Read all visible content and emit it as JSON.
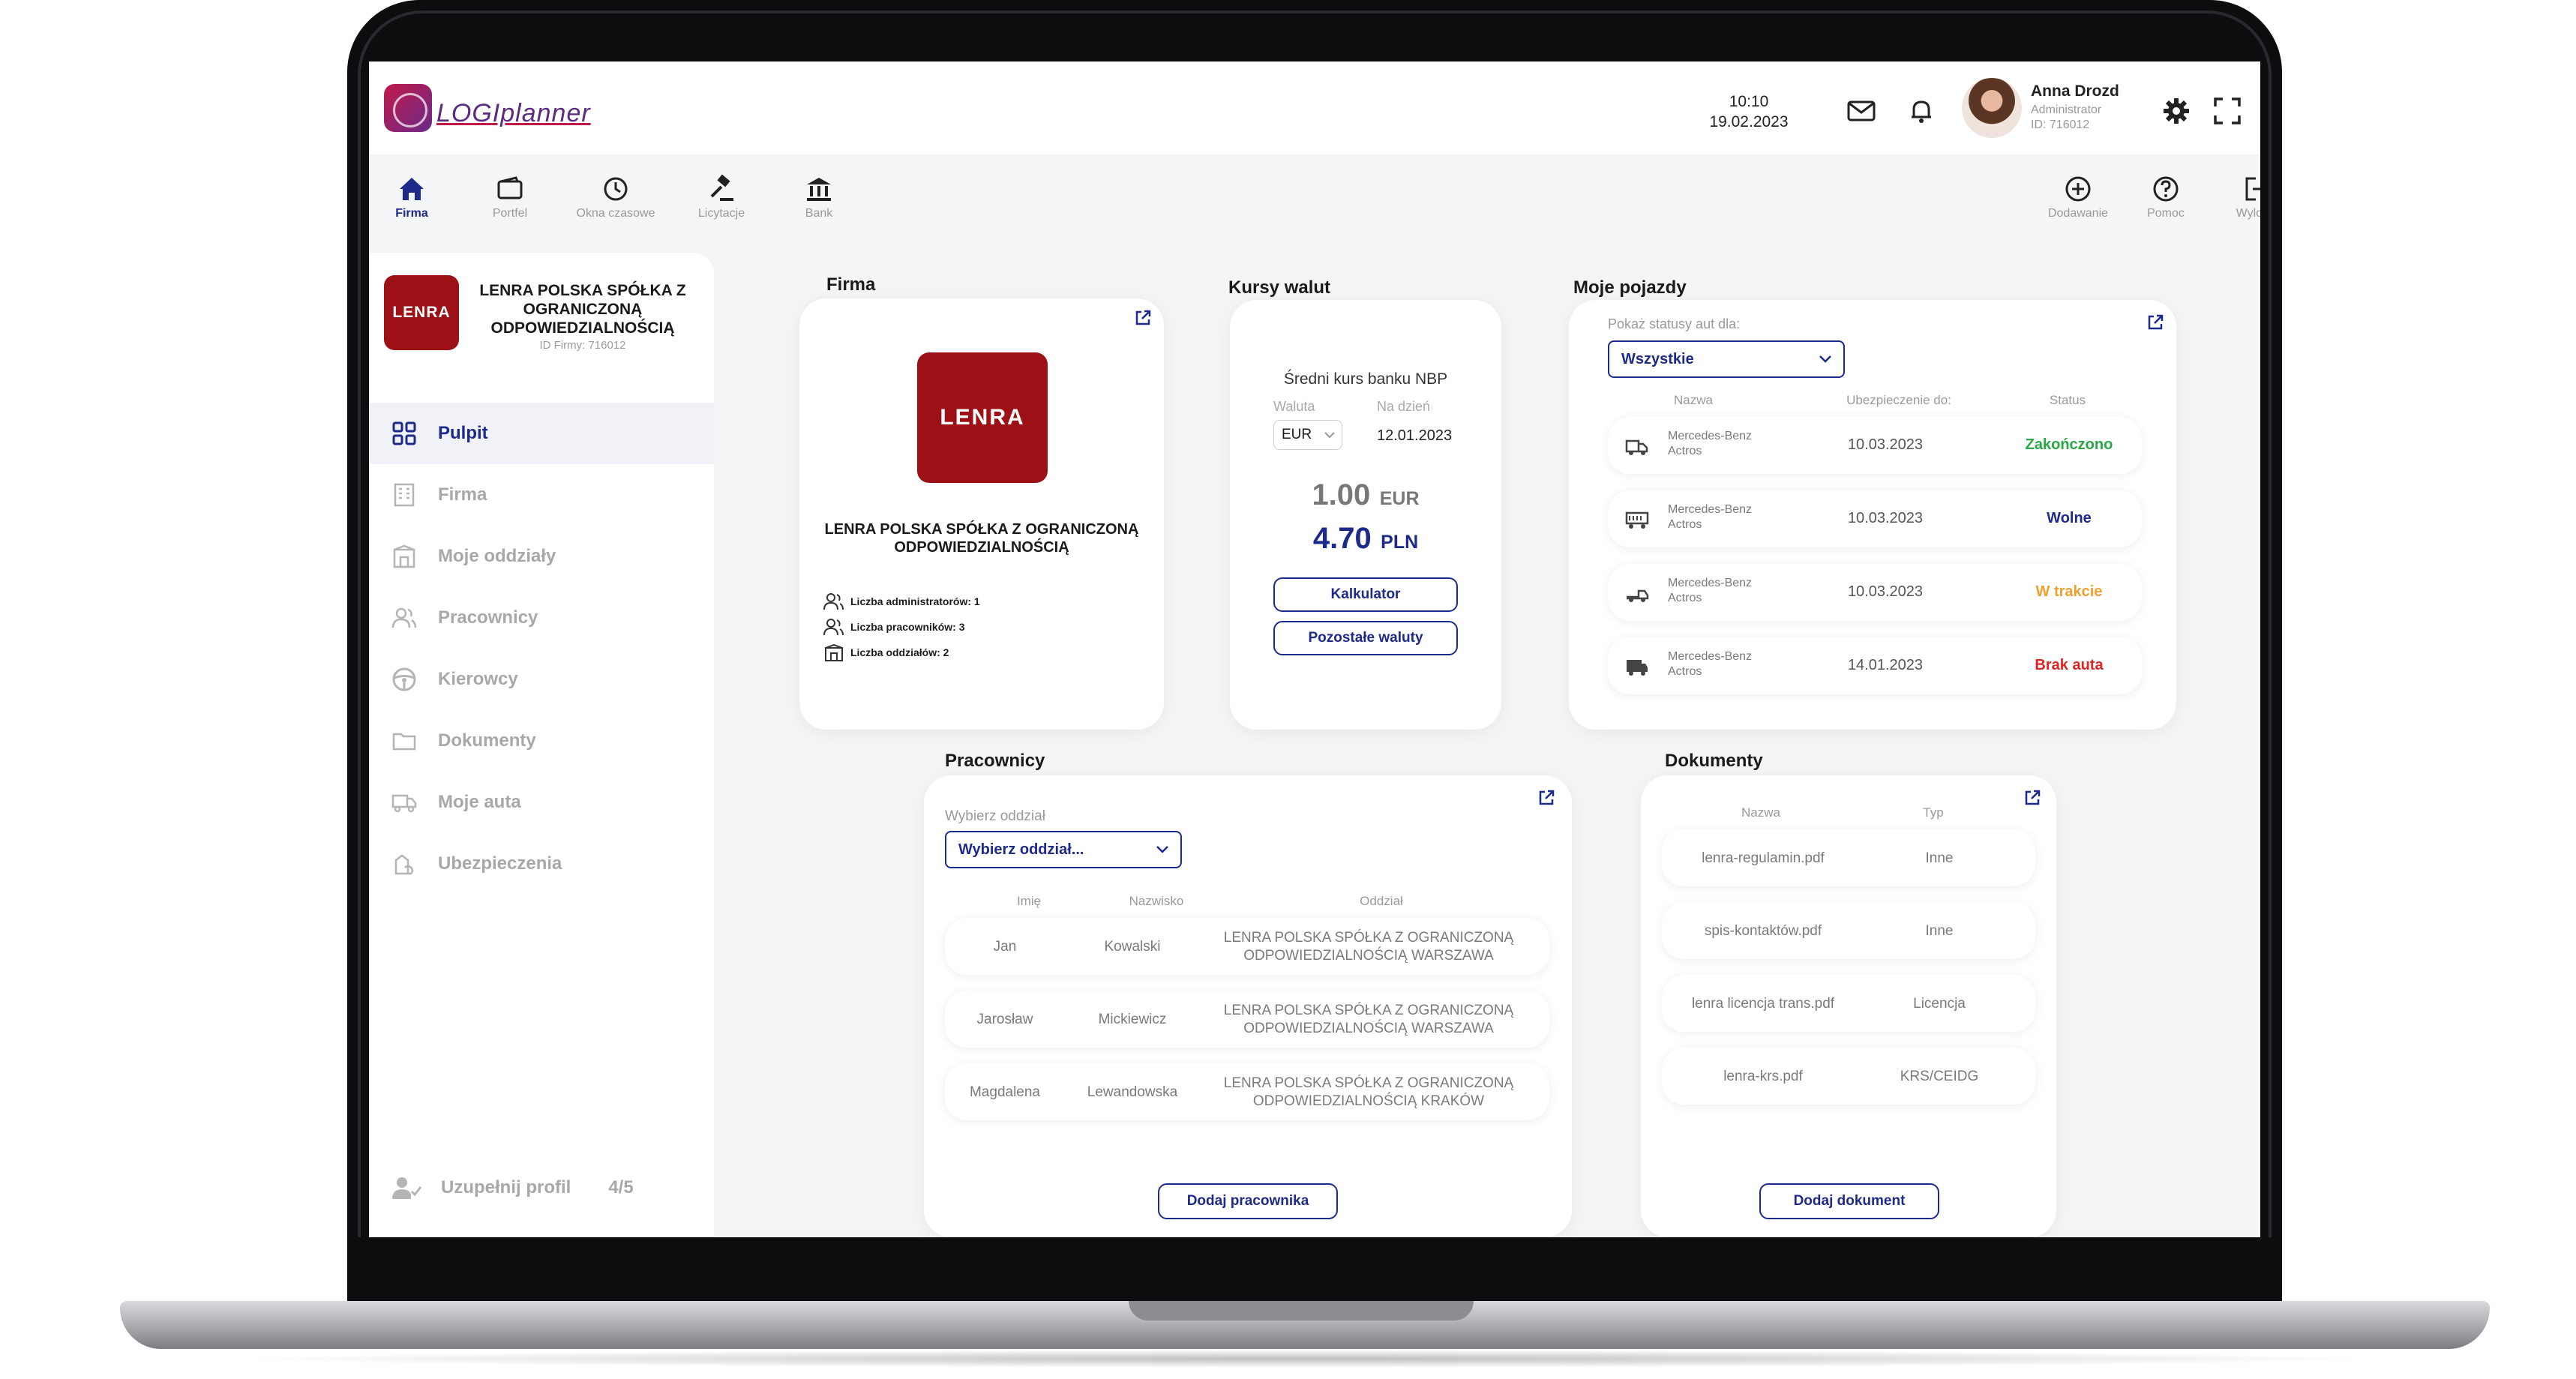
{
  "app": {
    "logo_text": "LOGIplanner"
  },
  "header": {
    "time": "10:10",
    "date": "19.02.2023",
    "user": {
      "name": "Anna Drozd",
      "role": "Administrator",
      "id": "ID: 716012"
    }
  },
  "nav": {
    "left": [
      {
        "label": "Firma",
        "icon": "home-icon"
      },
      {
        "label": "Portfel",
        "icon": "wallet-icon"
      },
      {
        "label": "Okna czasowe",
        "icon": "clock-icon"
      },
      {
        "label": "Licytacje",
        "icon": "gavel-icon"
      },
      {
        "label": "Bank",
        "icon": "bank-icon"
      }
    ],
    "right": [
      {
        "label": "Dodawanie",
        "icon": "plus-circle-icon"
      },
      {
        "label": "Pomoc",
        "icon": "help-icon"
      },
      {
        "label": "Wyloguj",
        "icon": "logout-icon"
      }
    ]
  },
  "sidebar": {
    "logo_text": "LENRA",
    "company_name": "LENRA POLSKA SPÓŁKA Z OGRANICZONĄ ODPOWIEDZIALNOŚCIĄ",
    "company_id": "ID Firmy: 716012",
    "items": [
      {
        "label": "Pulpit",
        "icon": "dashboard-grid-icon"
      },
      {
        "label": "Firma",
        "icon": "building-icon"
      },
      {
        "label": "Moje oddziały",
        "icon": "branch-icon"
      },
      {
        "label": "Pracownicy",
        "icon": "users-icon"
      },
      {
        "label": "Kierowcy",
        "icon": "steering-wheel-icon"
      },
      {
        "label": "Dokumenty",
        "icon": "folder-icon"
      },
      {
        "label": "Moje auta",
        "icon": "truck-icon"
      },
      {
        "label": "Ubezpieczenia",
        "icon": "insurance-icon"
      }
    ],
    "profile": {
      "label": "Uzupełnij profil",
      "count": "4/5"
    }
  },
  "firma": {
    "title": "Firma",
    "logo_text": "LENRA",
    "name": "LENRA POLSKA SPÓŁKA Z OGRANICZONĄ ODPOWIEDZIALNOŚCIĄ",
    "stats": [
      "Liczba administratorów: 1",
      "Liczba pracowników: 3",
      "Liczba oddziałów: 2"
    ]
  },
  "kursy": {
    "title": "Kursy walut",
    "subtitle": "Średni kurs banku NBP",
    "currency_label": "Waluta",
    "date_label": "Na dzień",
    "currency": "EUR",
    "date": "12.01.2023",
    "from_value": "1.00",
    "from_code": "EUR",
    "to_value": "4.70",
    "to_code": "PLN",
    "btn_calc": "Kalkulator",
    "btn_other": "Pozostałe waluty"
  },
  "pojazdy": {
    "title": "Moje pojazdy",
    "filter_label": "Pokaż statusy aut dla:",
    "filter_value": "Wszystkie",
    "headers": [
      "Nazwa",
      "Ubezpieczenie do:",
      "Status"
    ],
    "rows": [
      {
        "name1": "Mercedes-Benz",
        "name2": "Actros",
        "date": "10.03.2023",
        "status": "Zakończono",
        "color": "#27a844"
      },
      {
        "name1": "Mercedes-Benz",
        "name2": "Actros",
        "date": "10.03.2023",
        "status": "Wolne",
        "color": "#1e2a8a"
      },
      {
        "name1": "Mercedes-Benz",
        "name2": "Actros",
        "date": "10.03.2023",
        "status": "W trakcie",
        "color": "#f0a030"
      },
      {
        "name1": "Mercedes-Benz",
        "name2": "Actros",
        "date": "14.01.2023",
        "status": "Brak auta",
        "color": "#e02424"
      }
    ]
  },
  "pracownicy": {
    "title": "Pracownicy",
    "filter_label": "Wybierz oddział",
    "filter_value": "Wybierz oddział...",
    "headers": [
      "Imię",
      "Nazwisko",
      "Oddział"
    ],
    "rows": [
      {
        "first": "Jan",
        "last": "Kowalski",
        "branch1": "LENRA POLSKA SPÓŁKA Z OGRANICZONĄ",
        "branch2": "ODPOWIEDZIALNOŚCIĄ WARSZAWA"
      },
      {
        "first": "Jarosław",
        "last": "Mickiewicz",
        "branch1": "LENRA POLSKA SPÓŁKA Z OGRANICZONĄ",
        "branch2": "ODPOWIEDZIALNOŚCIĄ WARSZAWA"
      },
      {
        "first": "Magdalena",
        "last": "Lewandowska",
        "branch1": "LENRA POLSKA SPÓŁKA Z OGRANICZONĄ",
        "branch2": "ODPOWIEDZIALNOŚCIĄ KRAKÓW"
      }
    ],
    "button": "Dodaj pracownika"
  },
  "dokumenty": {
    "title": "Dokumenty",
    "headers": [
      "Nazwa",
      "Typ"
    ],
    "rows": [
      {
        "name": "lenra-regulamin.pdf",
        "type": "Inne"
      },
      {
        "name": "spis-kontaktów.pdf",
        "type": "Inne"
      },
      {
        "name": "lenra licencja trans.pdf",
        "type": "Licencja"
      },
      {
        "name": "lenra-krs.pdf",
        "type": "KRS/CEIDG"
      }
    ],
    "button": "Dodaj dokument"
  },
  "colors": {
    "accent": "#1e2a8a",
    "brand": "#9d1116",
    "background": "#f4f5f7"
  }
}
